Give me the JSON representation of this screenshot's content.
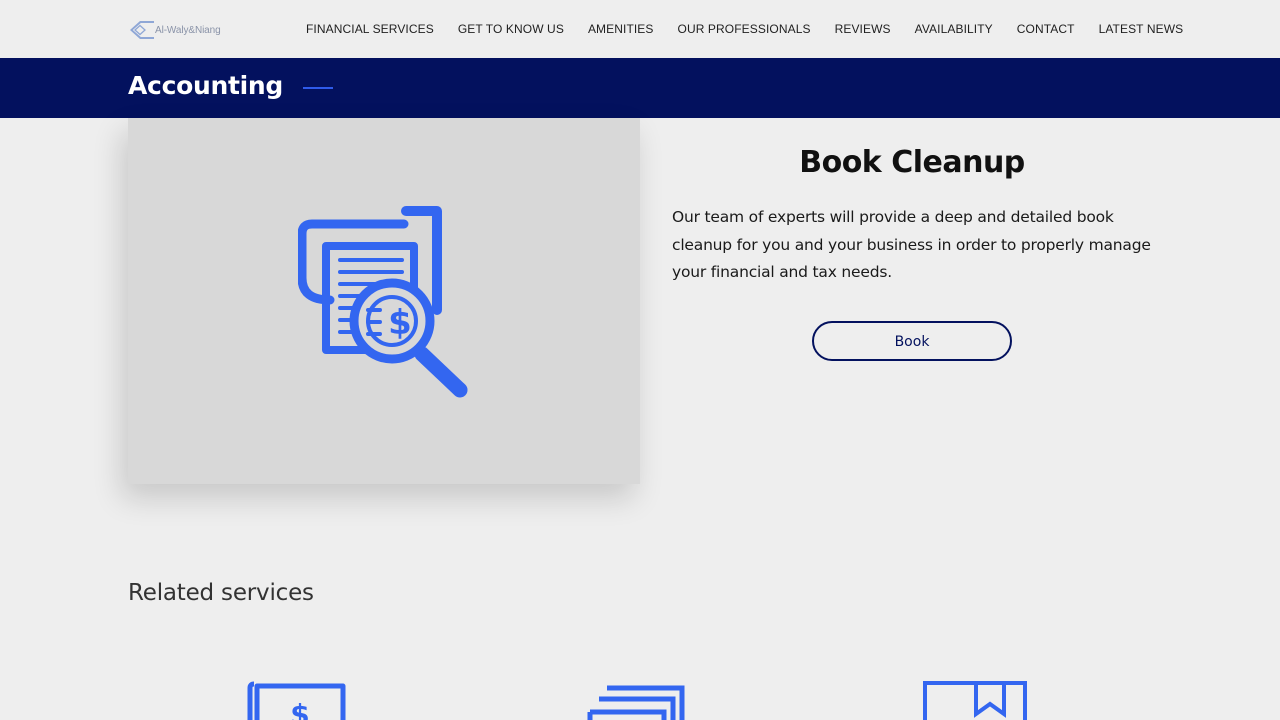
{
  "brand": {
    "name": "Al-Waly&Niang",
    "accent_color": "#2f5bea",
    "navy_color": "#03115e"
  },
  "nav": {
    "items": [
      {
        "label": "FINANCIAL SERVICES"
      },
      {
        "label": "GET TO KNOW US"
      },
      {
        "label": "AMENITIES"
      },
      {
        "label": "OUR PROFESSIONALS"
      },
      {
        "label": "REVIEWS"
      },
      {
        "label": "AVAILABILITY"
      },
      {
        "label": "CONTACT"
      },
      {
        "label": "LATEST NEWS"
      }
    ]
  },
  "page": {
    "category_title": "Accounting"
  },
  "service": {
    "icon": "document-magnifier-dollar-icon",
    "title": "Book Cleanup",
    "description": "Our team of experts will provide a deep and detailed book cleanup for you and your business in order to properly manage your financial and tax needs.",
    "button_label": "Book"
  },
  "related": {
    "title": "Related services",
    "items": [
      {
        "icon": "dollar-bill-icon"
      },
      {
        "icon": "stacked-documents-icon"
      },
      {
        "icon": "bookmark-box-icon"
      }
    ]
  }
}
